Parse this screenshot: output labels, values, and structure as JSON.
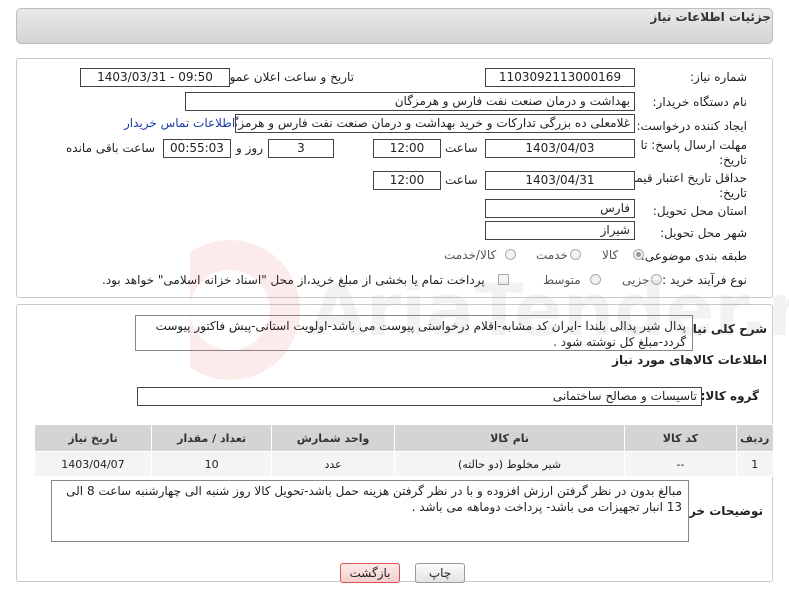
{
  "header": {
    "title": "جزئیات اطلاعات نیاز"
  },
  "fields": {
    "need_number_label": "شماره نیاز:",
    "need_number": "1103092113000169",
    "announce_label": "تاریخ و ساعت اعلان عمومی:",
    "announce_value": "1403/03/31 - 09:50",
    "buyer_label": "نام دستگاه خریدار:",
    "buyer": "بهداشت و درمان صنعت نفت فارس و هرمزگان",
    "creator_label": "ایجاد کننده درخواست:",
    "creator": "غلامعلی ده بزرگی تدارکات و خرید بهداشت و درمان صنعت نفت فارس و هرمزگان",
    "contact_link": "اطلاعات تماس خریدار",
    "deadline_label_1": "مهلت ارسال پاسخ: تا",
    "deadline_label_2": "تاریخ:",
    "deadline_date": "1403/04/03",
    "time_label": "ساعت",
    "deadline_time": "12:00",
    "days_value": "3",
    "days_label": "روز و",
    "remaining_time": "00:55:03",
    "remaining_label": "ساعت باقی مانده",
    "validity_label_1": "حداقل تاریخ اعتبار قیمت: تا",
    "validity_label_2": "تاریخ:",
    "validity_date": "1403/04/31",
    "validity_time": "12:00",
    "province_label": "استان محل تحویل:",
    "province": "فارس",
    "city_label": "شهر محل تحویل:",
    "city": "شیراز",
    "category_label": "طبقه بندی موضوعی:",
    "category_options": [
      "کالا",
      "خدمت",
      "کالا/خدمت"
    ],
    "purchase_label": "نوع فرآیند خرید :",
    "purchase_options": [
      "جزیی",
      "متوسط"
    ],
    "payment_note": "پرداخت تمام یا بخشی از مبلغ خرید،از محل \"اسناد خزانه اسلامی\" خواهد بود."
  },
  "description": {
    "label": "شرح کلی نیاز:",
    "text": "پدال شیر پدالی بلندا -ایران کد مشابه-اقلام درخواستی پیوست می باشد-اولویت استانی-پیش فاکتور پیوست گردد-مبلغ کل نوشته شود ."
  },
  "goods": {
    "section_title": "اطلاعات کالاهای مورد نیاز",
    "group_label": "گروه کالا:",
    "group_value": "تاسیسات و مصالح ساختمانی",
    "columns": [
      "ردیف",
      "کد کالا",
      "نام کالا",
      "واحد شمارش",
      "تعداد / مقدار",
      "تاریخ نیاز"
    ],
    "rows": [
      {
        "row": "1",
        "code": "--",
        "name": "شیر مخلوط (دو حالته)",
        "unit": "عدد",
        "qty": "10",
        "date": "1403/04/07"
      }
    ]
  },
  "notes": {
    "label": "توضیحات خریدار:",
    "text": "مبالغ بدون در نظر گرفتن ارزش افزوده و با در نظر گرفتن هزینه حمل باشد-تحویل کالا روز شنبه الی چهارشنبه ساعت 8 الی 13 انبار تجهیزات می باشد- پرداخت دوماهه می باشد ."
  },
  "buttons": {
    "print": "چاپ",
    "back": "بازگشت"
  },
  "watermark": "AriaTender.neT",
  "colors": {
    "link": "#1a3fa6",
    "back_button_border": "#d9534f"
  }
}
